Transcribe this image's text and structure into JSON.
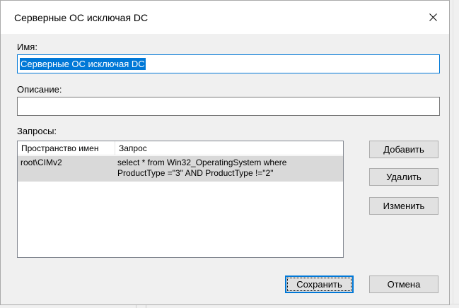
{
  "window": {
    "title": "Серверные ОС исключая DC",
    "close_icon": "close-icon"
  },
  "name_field": {
    "label": "Имя:",
    "value": "Серверные ОС исключая DC"
  },
  "description_field": {
    "label": "Описание:",
    "value": ""
  },
  "queries": {
    "label": "Запросы:",
    "columns": [
      "Пространство имен",
      "Запрос"
    ],
    "rows": [
      {
        "namespace": "root\\CIMv2",
        "query_line1": "select * from Win32_OperatingSystem where",
        "query_line2": "ProductType =\"3\" AND  ProductType !=\"2\""
      }
    ]
  },
  "side_buttons": {
    "add": "Добавить",
    "remove": "Удалить",
    "edit": "Изменить"
  },
  "footer_buttons": {
    "save": "Сохранить",
    "cancel": "Отмена"
  },
  "colors": {
    "accent": "#0078d7",
    "dialog_bg": "#f0f0f0",
    "selected_row": "#d9d9d9"
  }
}
